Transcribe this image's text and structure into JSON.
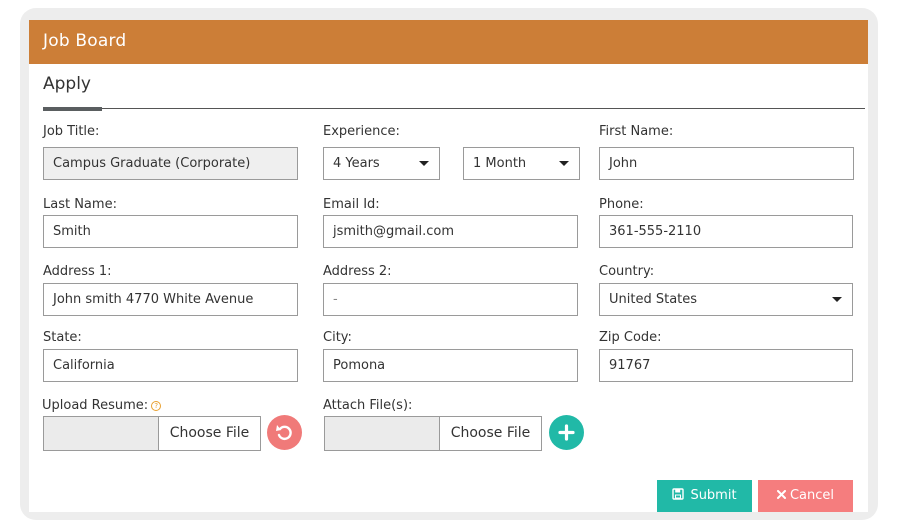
{
  "header": {
    "title": "Job Board"
  },
  "tabs": [
    {
      "label": "Apply",
      "active": true
    }
  ],
  "form": {
    "job_title": {
      "label": "Job Title:",
      "value": "Campus Graduate (Corporate)"
    },
    "experience": {
      "label": "Experience:",
      "years": "4 Years",
      "months": "1 Month"
    },
    "first_name": {
      "label": "First Name:",
      "value": "John"
    },
    "last_name": {
      "label": "Last Name:",
      "value": "Smith"
    },
    "email": {
      "label": "Email Id:",
      "value": "jsmith@gmail.com"
    },
    "phone": {
      "label": "Phone:",
      "value": "361-555-2110"
    },
    "address1": {
      "label": "Address 1:",
      "value": "John smith 4770 White Avenue"
    },
    "address2": {
      "label": "Address 2:",
      "value": "-"
    },
    "country": {
      "label": "Country:",
      "value": "United States"
    },
    "state": {
      "label": "State:",
      "value": "California"
    },
    "city": {
      "label": "City:",
      "value": "Pomona"
    },
    "zip": {
      "label": "Zip Code:",
      "value": "91767"
    },
    "resume": {
      "label": "Upload Resume:",
      "button": "Choose File",
      "help_icon": "?"
    },
    "attach": {
      "label": "Attach File(s):",
      "button": "Choose File"
    }
  },
  "actions": {
    "submit_label": "Submit",
    "cancel_label": "Cancel"
  },
  "colors": {
    "header": "#cc7e37",
    "submit": "#21b9a7",
    "cancel": "#f57d7e",
    "reset": "#f07a79",
    "add": "#21b9a7"
  },
  "icons": {
    "reset": "undo-icon",
    "add": "plus-icon",
    "submit": "save-icon",
    "cancel": "times-icon"
  }
}
